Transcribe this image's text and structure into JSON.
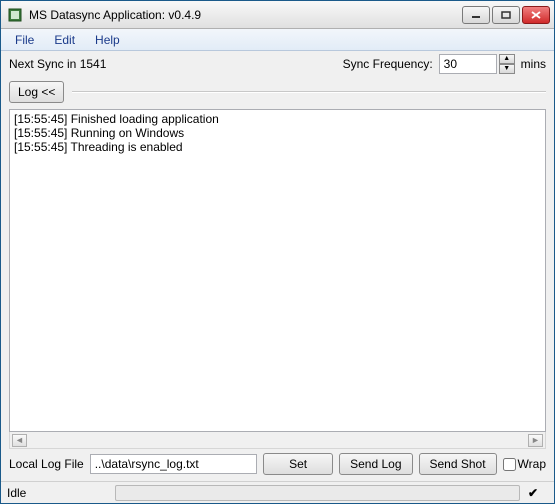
{
  "window": {
    "title": "MS Datasync Application: v0.4.9"
  },
  "menu": {
    "file": "File",
    "edit": "Edit",
    "help": "Help"
  },
  "sync": {
    "next_label_prefix": "Next Sync in ",
    "next_value": "1541",
    "freq_label": "Sync Frequency:",
    "freq_value": "30",
    "freq_unit": "mins"
  },
  "log_toggle_label": "Log <<",
  "log_lines": "[15:55:45] Finished loading application\n[15:55:45] Running on Windows\n[15:55:45] Threading is enabled",
  "logfile": {
    "label": "Local Log File",
    "path": "..\\data\\rsync_log.txt",
    "set_btn": "Set",
    "sendlog_btn": "Send Log",
    "sendshot_btn": "Send Shot",
    "wrap_label": "Wrap"
  },
  "status": {
    "text": "Idle"
  }
}
